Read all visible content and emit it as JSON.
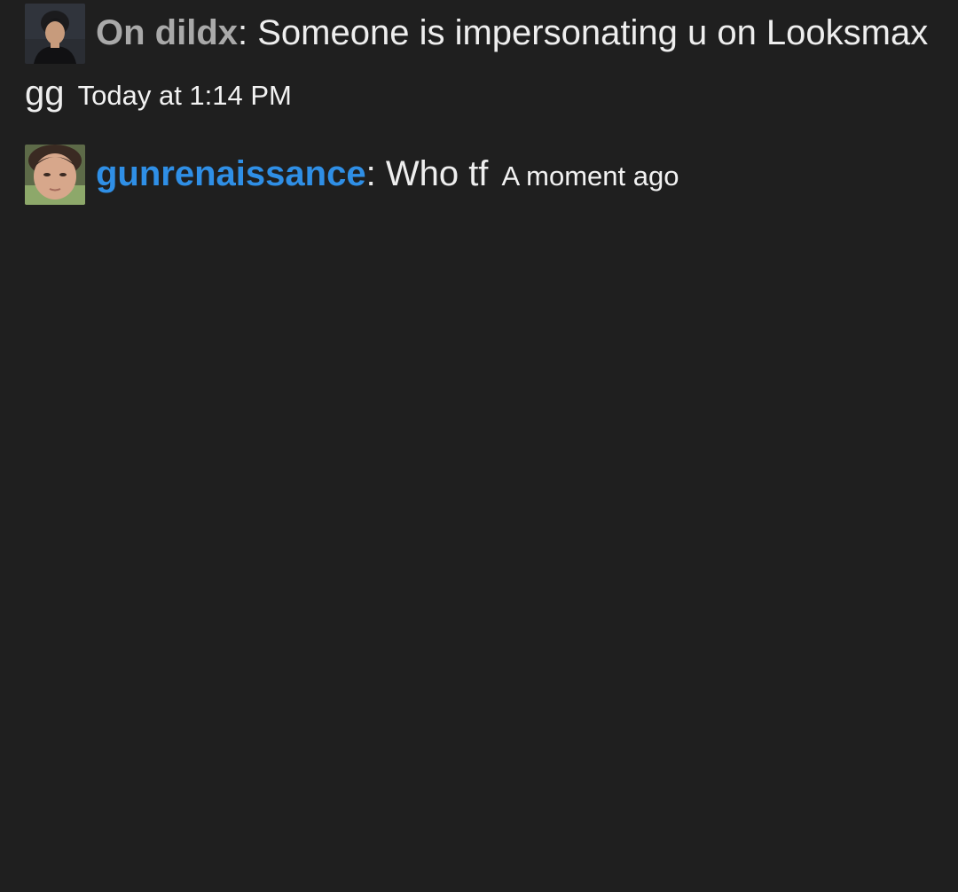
{
  "messages": [
    {
      "avatar_icon": "user-avatar-dark-hair",
      "username": "On dildx",
      "username_color": "#a9a9a9",
      "separator": ":",
      "text": "Someone is impersonating u on Looksmax gg",
      "time": "Today at 1:14 PM"
    },
    {
      "avatar_icon": "user-avatar-face",
      "username": "gunrenaissance",
      "username_color": "#2f8fe6",
      "separator": ":",
      "text": "Who tf",
      "time": "A moment ago"
    }
  ],
  "colors": {
    "background": "#1f1f1f",
    "text": "#e9e9e9"
  }
}
